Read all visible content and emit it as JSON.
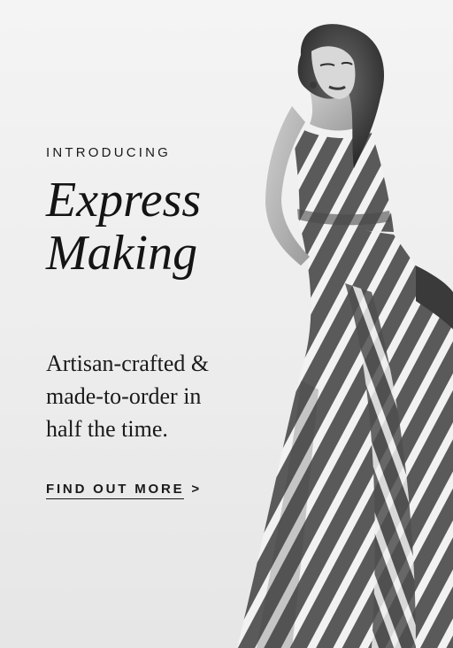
{
  "banner": {
    "eyebrow": "INTRODUCING",
    "headline_line1": "Express",
    "headline_line2": "Making",
    "subhead_line1": "Artisan-crafted &",
    "subhead_line2": "made-to-order in",
    "subhead_line3": "half the time.",
    "cta_label": "FIND OUT MORE",
    "cta_arrow": ">"
  },
  "colors": {
    "background": "#f0f0f0",
    "text": "#1a1a1a"
  }
}
